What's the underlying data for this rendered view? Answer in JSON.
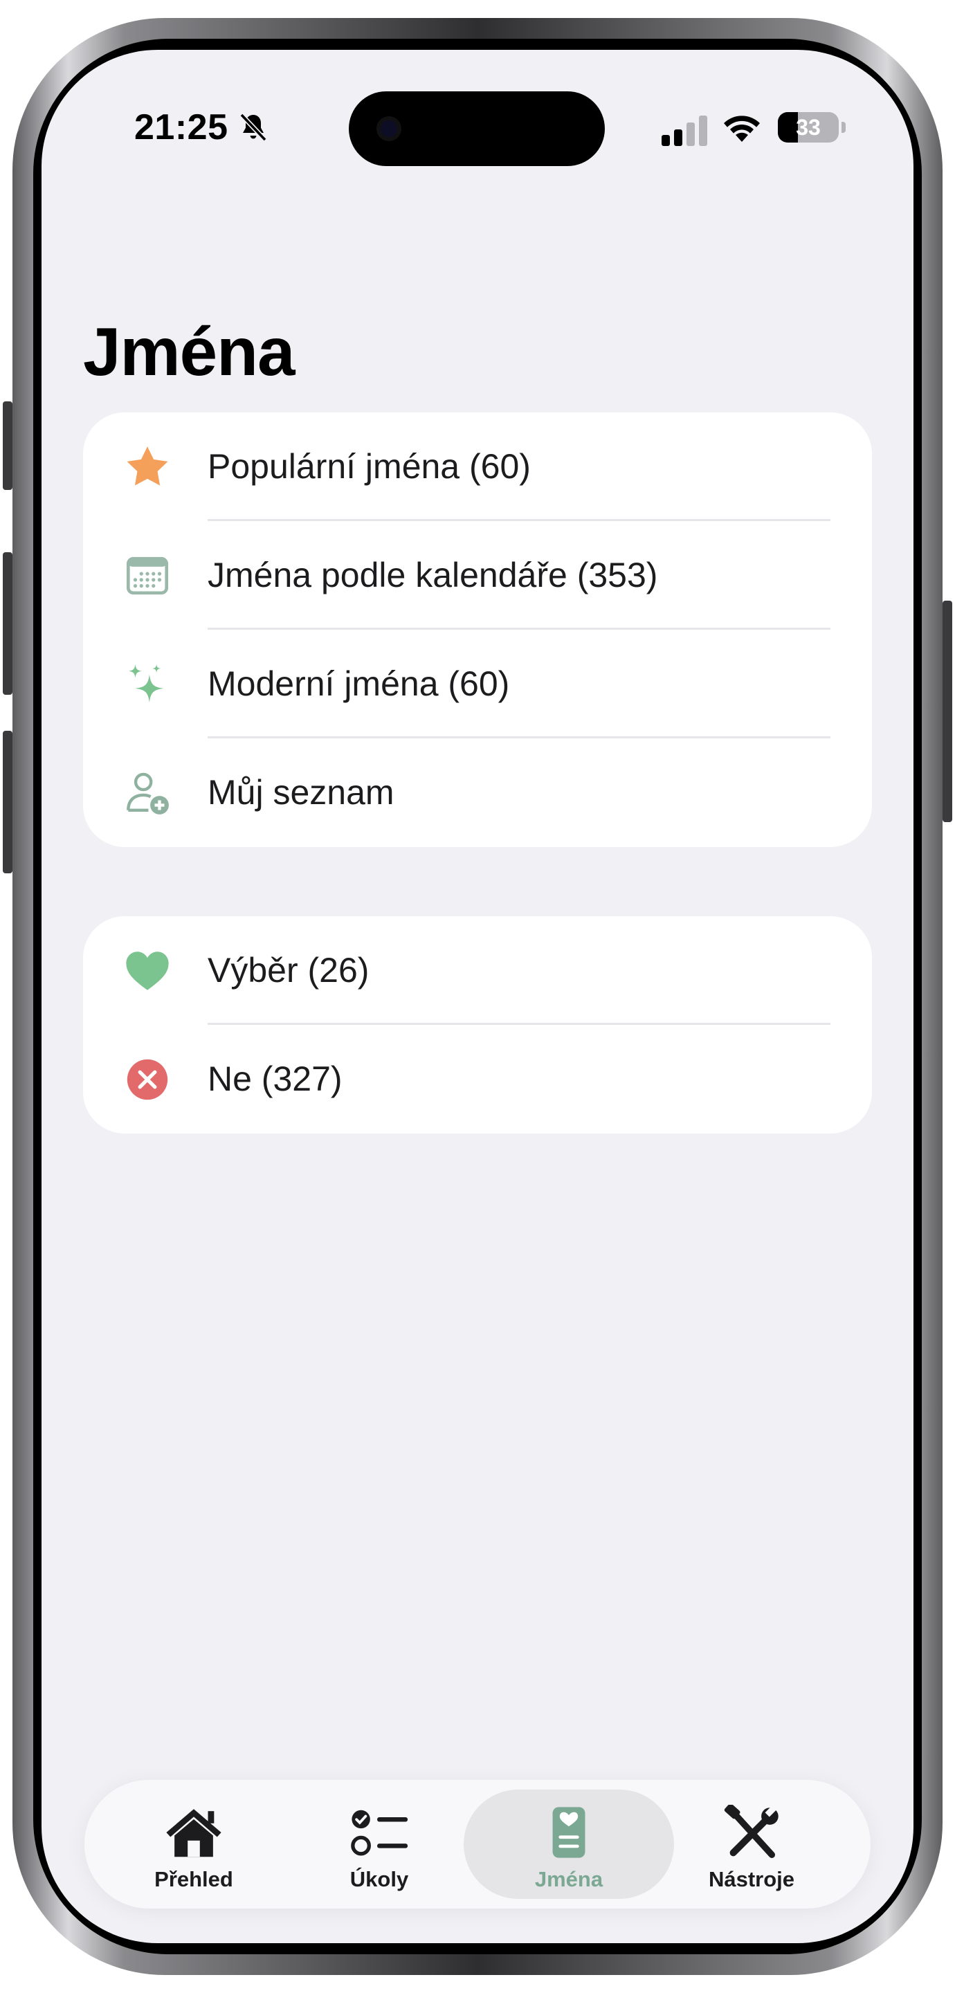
{
  "status_bar": {
    "time": "21:25",
    "battery_level": "33",
    "icons": [
      "bell-slash-icon",
      "cellular-signal-icon",
      "wifi-icon",
      "battery-icon"
    ]
  },
  "page": {
    "title": "Jména"
  },
  "list_primary": [
    {
      "label": "Populární jména (60)",
      "icon": "star-icon",
      "color": "#f5a05a"
    },
    {
      "label": "Jména podle kalendáře (353)",
      "icon": "calendar-icon",
      "color": "#9bb9ab"
    },
    {
      "label": "Moderní jména (60)",
      "icon": "sparkles-icon",
      "color": "#7cc48f"
    },
    {
      "label": "Můj seznam",
      "icon": "person-add-icon",
      "color": "#8fb2a0"
    }
  ],
  "list_secondary": [
    {
      "label": "Výběr (26)",
      "icon": "heart-icon",
      "color": "#7cc48f"
    },
    {
      "label": "Ne (327)",
      "icon": "x-circle-icon",
      "color": "#e26a6a"
    }
  ],
  "tab_bar": {
    "items": [
      {
        "label": "Přehled",
        "icon": "house-icon",
        "selected": false
      },
      {
        "label": "Úkoly",
        "icon": "checklist-icon",
        "selected": false
      },
      {
        "label": "Jména",
        "icon": "names-book-icon",
        "selected": true
      },
      {
        "label": "Nástroje",
        "icon": "tools-icon",
        "selected": false
      }
    ],
    "accent_color": "#7aa892"
  }
}
